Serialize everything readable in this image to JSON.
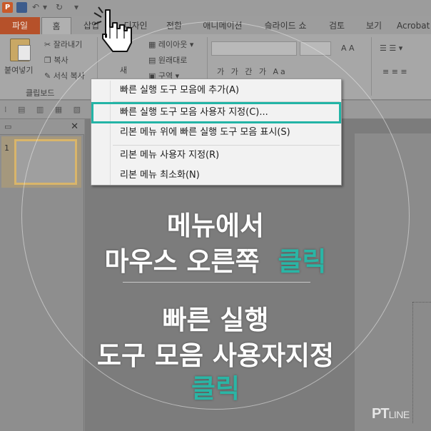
{
  "titlebar": {
    "app_icon_letter": "P",
    "qa_menu_glyph": "▾"
  },
  "tabs": {
    "file": "파일",
    "items": [
      "홈",
      "삽입",
      "디자인",
      "전환",
      "애니메이션",
      "슬라이드 쇼",
      "검토",
      "보기",
      "Acrobat"
    ]
  },
  "ribbon": {
    "paste": "붙여넣기",
    "cut": "잘라내기",
    "copy": "복사",
    "format_painter": "서식 복사",
    "clipboard_group": "클립보드",
    "new_slide": "새",
    "layout": "레이아웃",
    "reset": "원래대로",
    "section": "구역",
    "font_buttons": "가 가 가 가 가",
    "font_buttons2": "가 가 간 가 Aa"
  },
  "context_menu": {
    "items": [
      "빠른 실행 도구 모음에 추가(A)",
      "빠른 실행 도구 모음 사용자 지정(C)...",
      "리본 메뉴 위에 빠른 실행 도구 모음 표시(S)",
      "리본 메뉴 사용자 지정(R)",
      "리본 메뉴 최소화(N)"
    ],
    "highlighted_index": 1,
    "highlight_color": "#23b4a6"
  },
  "slide_pane": {
    "slide_number": "1",
    "close_glyph": "✕"
  },
  "overlay": {
    "line1": "메뉴에서",
    "line2_prefix": "마우스 오른쪽",
    "line2_accent": "클릭",
    "line3": "빠른 실행",
    "line4": "도구 모음 사용자지정",
    "line5_accent": "클릭",
    "accent_color": "#2ab5a5"
  },
  "brand": {
    "pt": "PT",
    "line": "LINE"
  }
}
